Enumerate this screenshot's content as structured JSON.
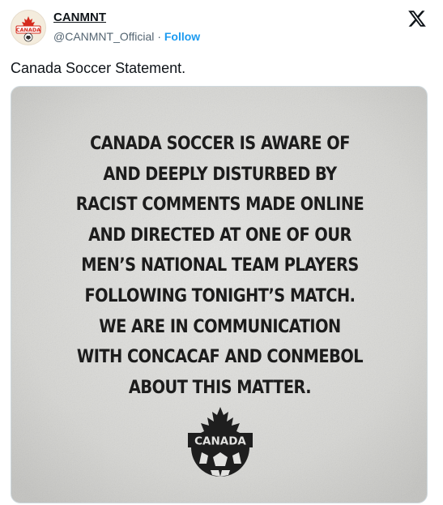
{
  "tweet": {
    "display_name": "CANMNT",
    "handle": "@CANMNT_Official",
    "separator": "·",
    "follow_label": "Follow",
    "text": "Canada Soccer Statement.",
    "platform_icon": "x-logo-icon"
  },
  "avatar": {
    "icon": "canada-soccer-crest-icon",
    "label": "CANADA"
  },
  "media": {
    "statement_lines": [
      "CANADA SOCCER IS AWARE OF",
      "AND DEEPLY DISTURBED BY",
      "RACIST COMMENTS MADE ONLINE",
      "AND DIRECTED AT ONE OF OUR",
      "MEN’S NATIONAL TEAM PLAYERS",
      "FOLLOWING TONIGHT’S MATCH.",
      "WE ARE IN COMMUNICATION",
      "WITH CONCACAF AND CONMEBOL",
      "ABOUT THIS MATTER."
    ],
    "logo_text": "CANADA",
    "logo_icon": "canada-soccer-logo-icon"
  },
  "colors": {
    "follow_blue": "#1d9bf0",
    "handle_gray": "#536471",
    "statement_ink": "#1c1c1c",
    "crest_red": "#d52b1e"
  }
}
